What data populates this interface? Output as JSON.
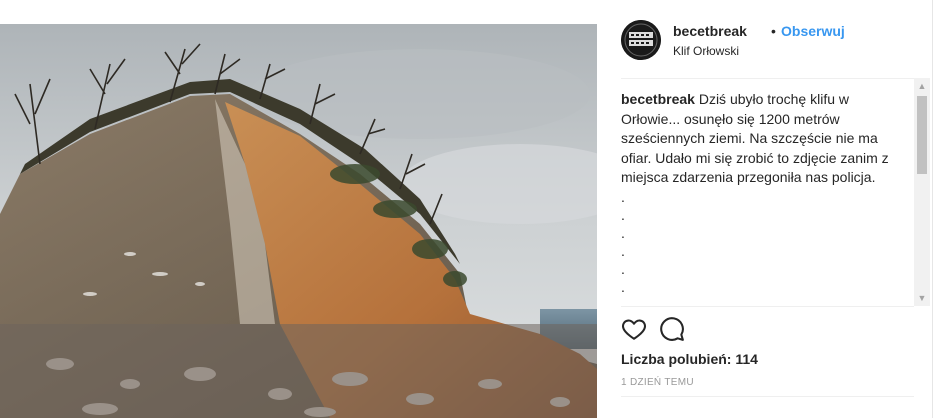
{
  "post": {
    "username": "becetbreak",
    "separator": "•",
    "follow_label": "Obserwuj",
    "location": "Klif Orłowski",
    "avatar_text": "BECET BREAK",
    "caption": {
      "username": "becetbreak",
      "text": "Dziś ubyło trochę klifu w Orłowie... osunęło się 1200 metrów sześciennych ziemi. Na szczęście nie ma ofiar. Udało mi się zrobić to zdjęcie zanim z miejsca zdarzenia przegoniła nas policja.",
      "dots": [
        ".",
        ".",
        ".",
        ".",
        ".",
        ".",
        "."
      ]
    },
    "likes": "Liczba polubień: 114",
    "timestamp": "1 dzień temu"
  },
  "icons": {
    "like": "heart-icon",
    "comment": "comment-icon",
    "scroll_up": "arrow-up-icon",
    "scroll_down": "arrow-down-icon"
  },
  "colors": {
    "accent": "#3897f0",
    "text": "#262626",
    "muted": "#999999"
  }
}
